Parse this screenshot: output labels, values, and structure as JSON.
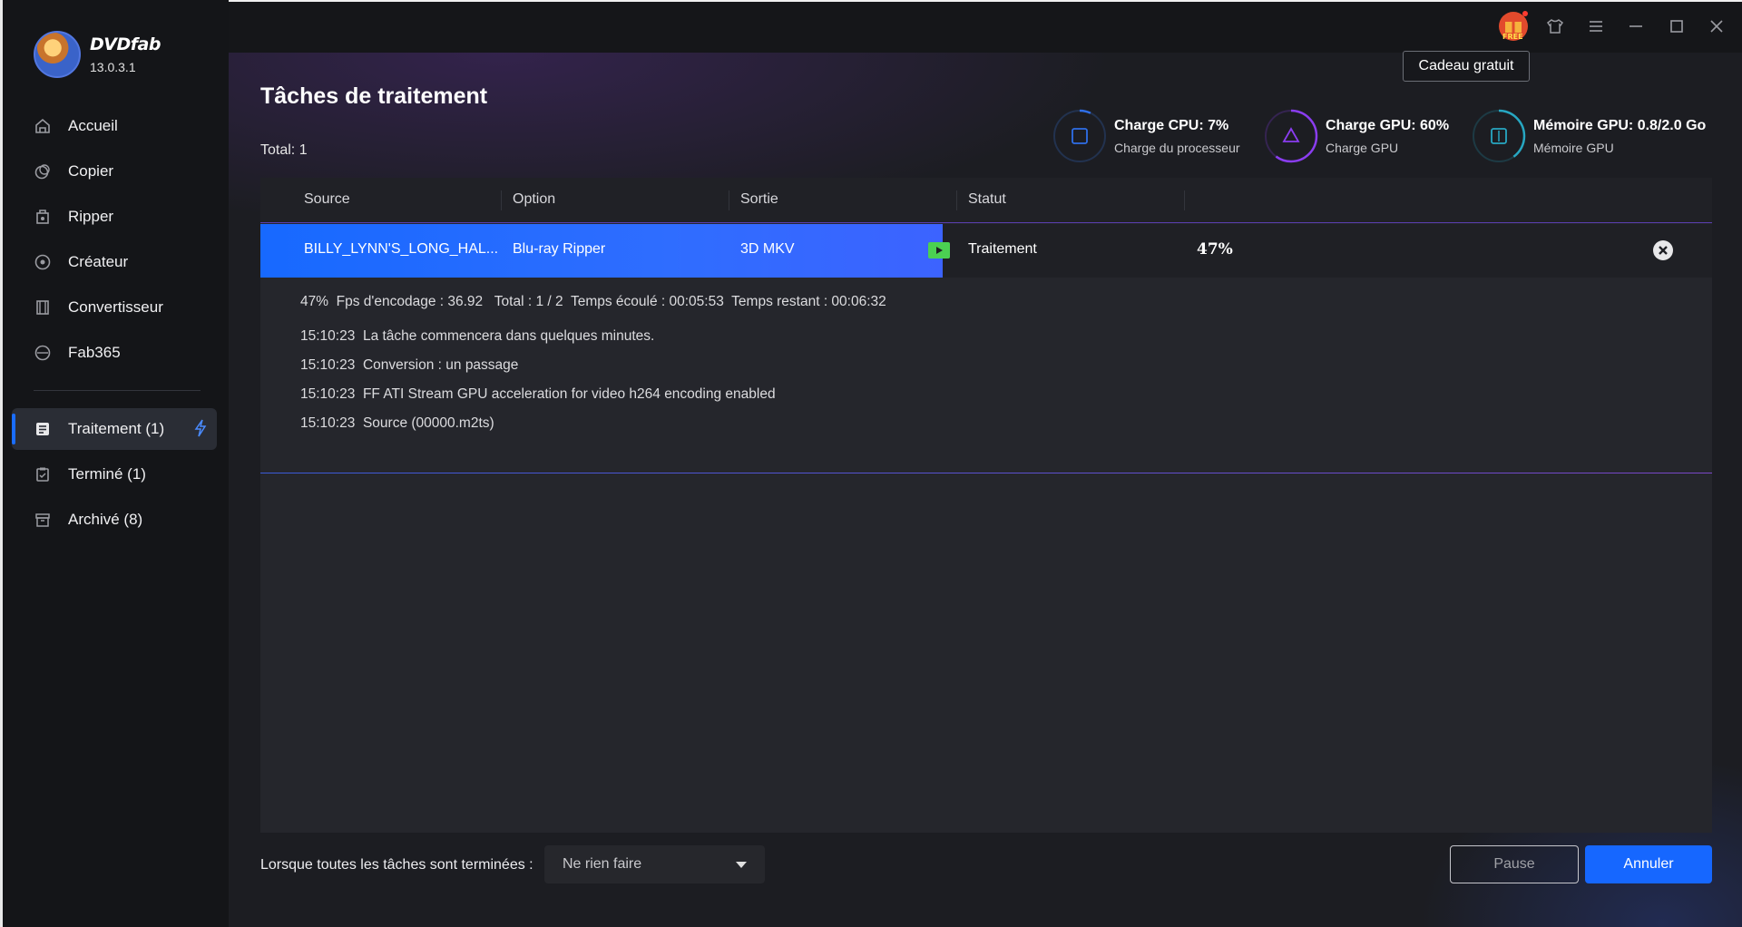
{
  "app": {
    "brand": "DVDfab",
    "version": "13.0.3.1"
  },
  "sidebar": {
    "items": [
      {
        "label": "Accueil",
        "icon": "home-icon"
      },
      {
        "label": "Copier",
        "icon": "copy-icon"
      },
      {
        "label": "Ripper",
        "icon": "ripper-icon"
      },
      {
        "label": "Créateur",
        "icon": "creator-icon"
      },
      {
        "label": "Convertisseur",
        "icon": "converter-icon"
      },
      {
        "label": "Fab365",
        "icon": "fab365-icon"
      }
    ],
    "queue": [
      {
        "label": "Traitement (1)",
        "icon": "processing-icon",
        "active": true
      },
      {
        "label": "Terminé (1)",
        "icon": "finished-icon"
      },
      {
        "label": "Archivé (8)",
        "icon": "archive-icon"
      }
    ]
  },
  "topbar": {
    "tooltip": "Cadeau gratuit",
    "gift_badge": "FREE"
  },
  "page": {
    "title": "Tâches de traitement",
    "total": "Total: 1"
  },
  "meters": {
    "cpu": {
      "title": "Charge CPU: 7%",
      "sub": "Charge du processeur",
      "value": 0.07
    },
    "gpu": {
      "title": "Charge GPU: 60%",
      "sub": "Charge GPU",
      "value": 0.6
    },
    "mem": {
      "title": "Mémoire GPU: 0.8/2.0 Go",
      "sub": "Mémoire GPU",
      "value": 0.4
    }
  },
  "table": {
    "headers": [
      "Source",
      "Option",
      "Sortie",
      "Statut"
    ],
    "row": {
      "source": "BILLY_LYNN'S_LONG_HAL...",
      "option": "Blu-ray Ripper",
      "output": "3D MKV",
      "status": "Traitement",
      "percent": "47%",
      "progress": 0.47
    },
    "log": [
      "47%  Fps d'encodage : 36.92   Total : 1 / 2  Temps écoulé : 00:05:53  Temps restant : 00:06:32",
      "15:10:23  La tâche commencera dans quelques minutes.",
      "15:10:23  Conversion : un passage",
      "15:10:23  FF ATI Stream GPU acceleration for video h264 encoding enabled",
      "15:10:23  Source (00000.m2ts)"
    ]
  },
  "footer": {
    "label": "Lorsque toutes les tâches sont terminées :",
    "select_value": "Ne rien faire",
    "pause": "Pause",
    "cancel": "Annuler"
  },
  "colors": {
    "accent": "#1667ff",
    "play": "#4bd052",
    "cpu_ring": "#1f4fb8",
    "gpu_ring": "#7a2fd0",
    "mem_ring": "#1e8fa8"
  }
}
